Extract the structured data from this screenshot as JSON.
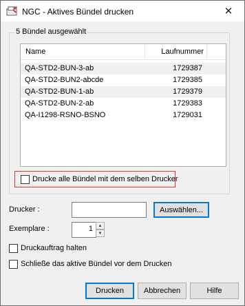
{
  "window": {
    "title": "NGC - Aktives Bündel drucken",
    "close_glyph": "✕"
  },
  "group": {
    "caption": "5 Bündel ausgewählt"
  },
  "list": {
    "columns": [
      "Name",
      "Laufnummer"
    ],
    "rows": [
      {
        "name": "QA-STD2-BUN-3-ab",
        "number": "1729387"
      },
      {
        "name": "QA-STD2-BUN2-abcde",
        "number": "1729385"
      },
      {
        "name": "QA-STD2-BUN-1-ab",
        "number": "1729379"
      },
      {
        "name": "QA-STD2-BUN-2-ab",
        "number": "1729383"
      },
      {
        "name": "QA-I1298-RSNO-BSNO",
        "number": "1729031"
      }
    ]
  },
  "options": {
    "same_printer_label": "Drucke alle Bündel mit dem selben Drucker",
    "hold_job_label": "Druckauftrag halten",
    "close_bundle_label": "Schließe das aktive Bündel vor dem Drucken"
  },
  "printer": {
    "label": "Drucker :",
    "value": "",
    "select_button": "Auswählen..."
  },
  "copies": {
    "label": "Exemplare :",
    "value": "1"
  },
  "buttons": {
    "print": "Drucken",
    "cancel": "Abbrechen",
    "help": "Hilfe"
  },
  "colors": {
    "highlight_frame": "#d9383a",
    "default_button_border": "#0078d7"
  }
}
